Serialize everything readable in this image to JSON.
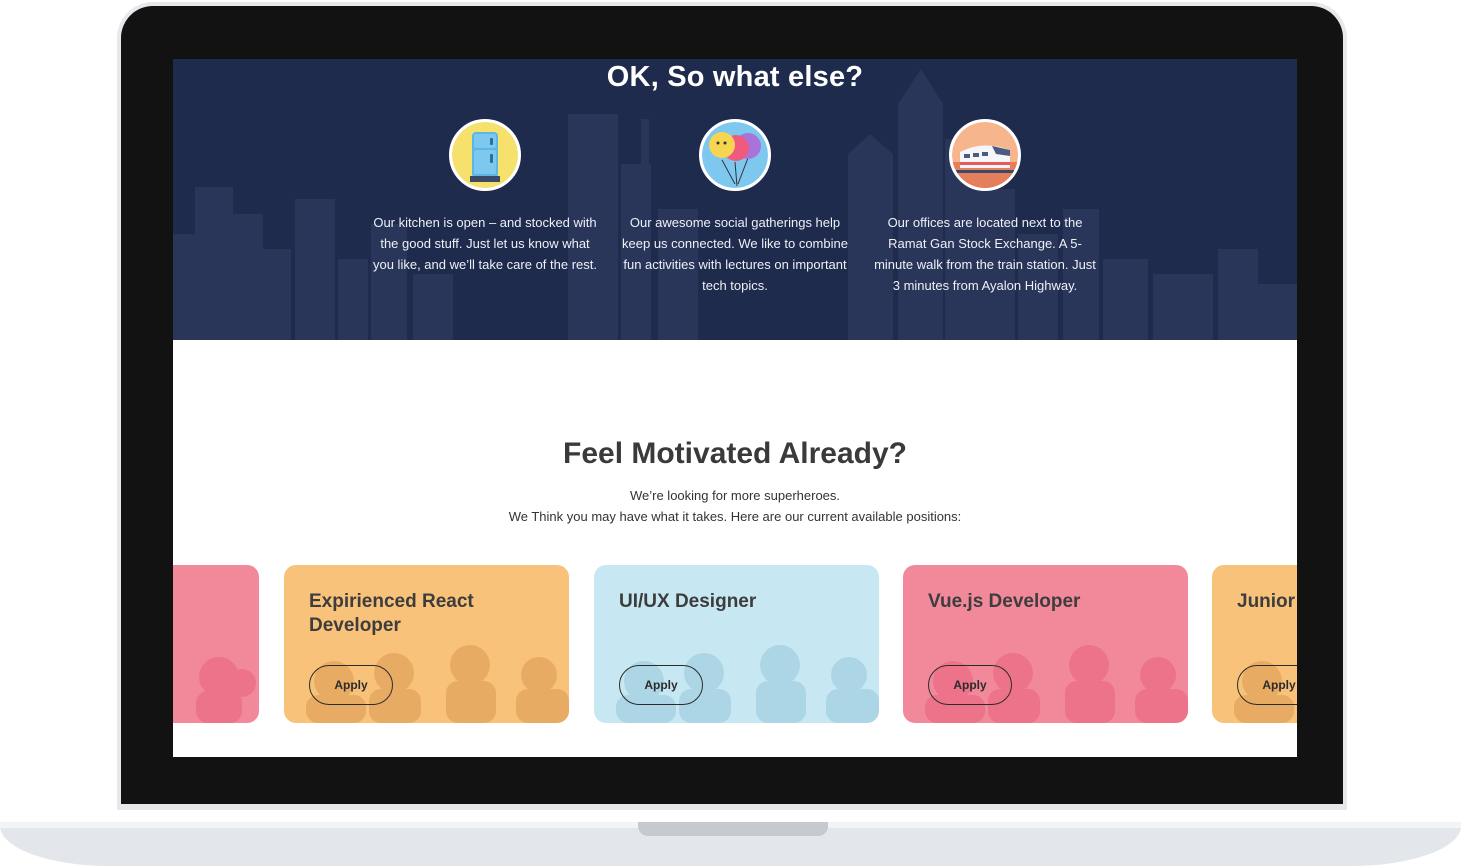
{
  "perks": {
    "title": "OK, So what else?",
    "items": [
      {
        "icon": "fridge-icon",
        "text": "Our kitchen is open – and stocked with the good stuff. Just let us know what you like, and we’ll take care of the rest."
      },
      {
        "icon": "balloons-icon",
        "text": "Our awesome social gatherings help keep us connected. We like to combine fun activities with lectures on important tech topics."
      },
      {
        "icon": "train-icon",
        "text": "Our offices are located next to the Ramat Gan Stock Exchange. A 5-minute walk from the train station. Just 3 minutes from Ayalon Highway."
      }
    ]
  },
  "motivated": {
    "title": "Feel Motivated Already?",
    "subtitle_line1": "We’re looking for more superheroes.",
    "subtitle_line2": "We Think you may have what it takes. Here are our current available positions:"
  },
  "jobs": [
    {
      "title": "",
      "apply": "",
      "color": "#f2899b",
      "shade": "#ec7389"
    },
    {
      "title": "Expirienced React Developer",
      "apply": "Apply",
      "color": "#f9c27a",
      "shade": "#e8ab63"
    },
    {
      "title": "UI/UX Designer",
      "apply": "Apply",
      "color": "#c7e8f3",
      "shade": "#acd6e6"
    },
    {
      "title": "Vue.js Developer",
      "apply": "Apply",
      "color": "#f2899b",
      "shade": "#ec7389"
    },
    {
      "title": "Junior",
      "apply": "Apply",
      "color": "#f9c27a",
      "shade": "#e8ab63"
    }
  ],
  "colors": {
    "hero_bg": "#1f2b4d",
    "skyline": "#2a3659"
  }
}
